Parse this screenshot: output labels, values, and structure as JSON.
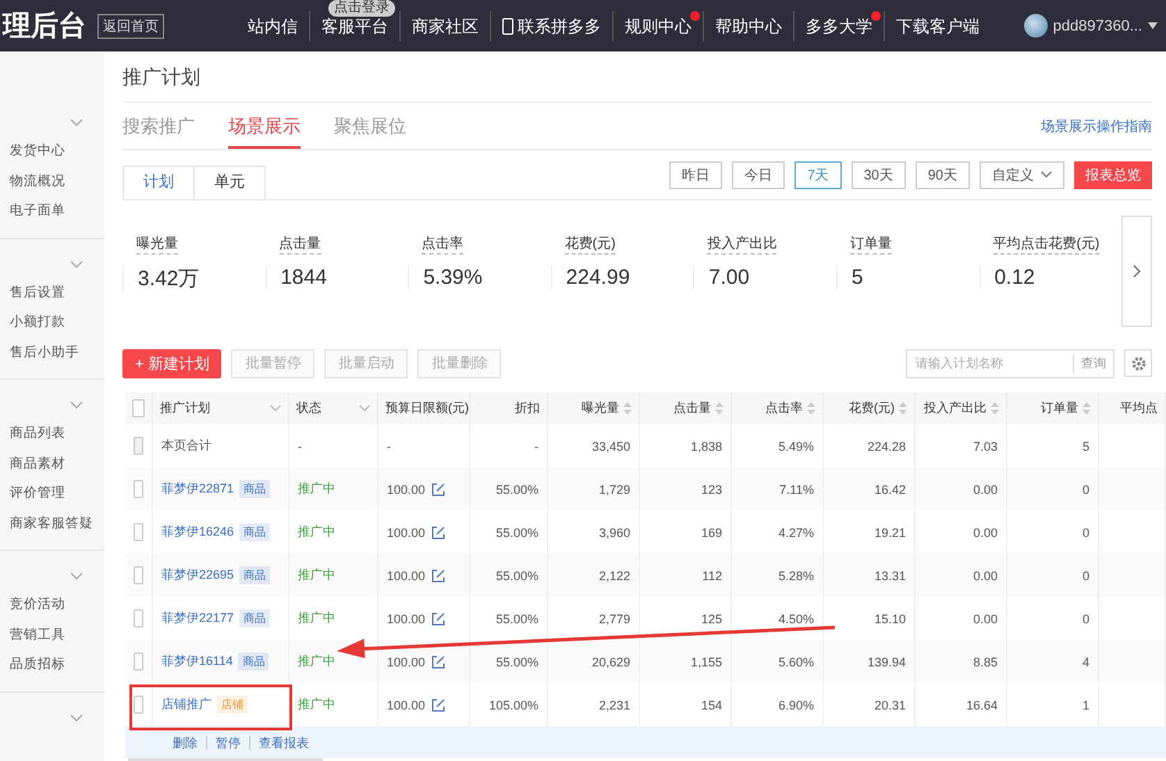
{
  "topbar": {
    "logo": "理后台",
    "home_button": "返回首页",
    "login_bubble": "点击登录",
    "nav": [
      {
        "label": "站内信",
        "kind": "text",
        "dot": false
      },
      {
        "label": "客服平台",
        "kind": "text",
        "dot": false
      },
      {
        "label": "商家社区",
        "kind": "text",
        "dot": false
      },
      {
        "label": "联系拼多多",
        "kind": "phone",
        "dot": false
      },
      {
        "label": "规则中心",
        "kind": "text",
        "dot": true
      },
      {
        "label": "帮助中心",
        "kind": "text",
        "dot": false
      },
      {
        "label": "多多大学",
        "kind": "text",
        "dot": true
      },
      {
        "label": "下载客户端",
        "kind": "text",
        "dot": false
      }
    ],
    "user": "pdd897360..."
  },
  "sidebar": {
    "groups": [
      {
        "expanded": true,
        "items": [
          "发货中心",
          "物流概况",
          "电子面单"
        ]
      },
      {
        "expanded": true,
        "items": [
          "售后设置",
          "小额打款",
          "售后小助手"
        ]
      },
      {
        "expanded": true,
        "items": [
          "商品列表",
          "商品素材",
          "评价管理",
          "商家客服答疑"
        ]
      },
      {
        "expanded": true,
        "items": [
          "竞价活动",
          "营销工具",
          "品质招标"
        ]
      },
      {
        "expanded": true
      }
    ]
  },
  "page_title": "推广计划",
  "tabs": [
    {
      "label": "搜索推广",
      "selected": false
    },
    {
      "label": "场景展示",
      "selected": true
    },
    {
      "label": "聚焦展位",
      "selected": false
    }
  ],
  "guide_link": "场景展示操作指南",
  "subtabs": [
    {
      "label": "计划",
      "selected": true
    },
    {
      "label": "单元",
      "selected": false
    }
  ],
  "date_ranges": [
    {
      "label": "昨日",
      "selected": false,
      "kind": "plain"
    },
    {
      "label": "今日",
      "selected": false,
      "kind": "plain"
    },
    {
      "label": "7天",
      "selected": true,
      "kind": "plain"
    },
    {
      "label": "30天",
      "selected": false,
      "kind": "plain"
    },
    {
      "label": "90天",
      "selected": false,
      "kind": "plain"
    },
    {
      "label": "自定义",
      "selected": false,
      "kind": "dropdown"
    }
  ],
  "report_button": "报表总览",
  "stats": [
    {
      "label": "曝光量",
      "value": "3.42万"
    },
    {
      "label": "点击量",
      "value": "1844"
    },
    {
      "label": "点击率",
      "value": "5.39%"
    },
    {
      "label": "花费(元)",
      "value": "224.99"
    },
    {
      "label": "投入产出比",
      "value": "7.00"
    },
    {
      "label": "订单量",
      "value": "5"
    },
    {
      "label": "平均点击花费(元)",
      "value": "0.12"
    }
  ],
  "toolbar": {
    "new_button": "+ 新建计划",
    "batch_buttons": [
      {
        "label": "批量暂停",
        "disabled": true
      },
      {
        "label": "批量启动",
        "disabled": true
      },
      {
        "label": "批量删除",
        "disabled": true
      }
    ],
    "search": {
      "placeholder": "请输入计划名称"
    },
    "search_button": "查询"
  },
  "table": {
    "select_all_checked": false,
    "columns": [
      {
        "label": "推广计划",
        "kind": "filter"
      },
      {
        "label": "状态",
        "kind": "filter"
      },
      {
        "label": "预算日限额(元)",
        "kind": "plain"
      },
      {
        "label": "折扣",
        "kind": "plain"
      },
      {
        "label": "曝光量",
        "kind": "sort"
      },
      {
        "label": "点击量",
        "kind": "sort"
      },
      {
        "label": "点击率",
        "kind": "sort"
      },
      {
        "label": "花费(元)",
        "kind": "sort"
      },
      {
        "label": "投入产出比",
        "kind": "sort"
      },
      {
        "label": "订单量",
        "kind": "sort"
      },
      {
        "label": "平均点",
        "kind": "plain"
      }
    ],
    "rows": [
      {
        "kind": "summary",
        "checked": false,
        "name": "本页合计",
        "status": "-",
        "budget": "-",
        "discount": "-",
        "values": [
          "33,450",
          "1,838",
          "5.49%",
          "224.28",
          "7.03",
          "5"
        ]
      },
      {
        "kind": "plan",
        "checked": false,
        "highlighted": false,
        "name": "菲梦伊22871",
        "tag": {
          "label": "商品",
          "color": "#3a72c8"
        },
        "status": "推广中",
        "budget": "100.00",
        "discount": "55.00%",
        "values": [
          "1,729",
          "123",
          "7.11%",
          "16.42",
          "0.00",
          "0"
        ]
      },
      {
        "kind": "plan",
        "checked": false,
        "highlighted": false,
        "name": "菲梦伊16246",
        "tag": {
          "label": "商品",
          "color": "#3a72c8"
        },
        "status": "推广中",
        "budget": "100.00",
        "discount": "55.00%",
        "values": [
          "3,960",
          "169",
          "4.27%",
          "19.21",
          "0.00",
          "0"
        ]
      },
      {
        "kind": "plan",
        "checked": false,
        "highlighted": false,
        "name": "菲梦伊22695",
        "tag": {
          "label": "商品",
          "color": "#3a72c8"
        },
        "status": "推广中",
        "budget": "100.00",
        "discount": "55.00%",
        "values": [
          "2,122",
          "112",
          "5.28%",
          "13.31",
          "0.00",
          "0"
        ]
      },
      {
        "kind": "plan",
        "checked": false,
        "highlighted": false,
        "name": "菲梦伊22177",
        "tag": {
          "label": "商品",
          "color": "#3a72c8"
        },
        "status": "推广中",
        "budget": "100.00",
        "discount": "55.00%",
        "values": [
          "2,779",
          "125",
          "4.50%",
          "15.10",
          "0.00",
          "0"
        ]
      },
      {
        "kind": "plan",
        "checked": false,
        "highlighted": false,
        "name": "菲梦伊16114",
        "tag": {
          "label": "商品",
          "color": "#3a72c8"
        },
        "status": "推广中",
        "budget": "100.00",
        "discount": "55.00%",
        "values": [
          "20,629",
          "1,155",
          "5.60%",
          "139.94",
          "8.85",
          "4"
        ]
      },
      {
        "kind": "plan",
        "checked": false,
        "highlighted": true,
        "name": "店铺推广",
        "tag": {
          "label": "店铺",
          "color": "#e8952c"
        },
        "status": "推广中",
        "budget": "100.00",
        "discount": "105.00%",
        "values": [
          "2,231",
          "154",
          "6.90%",
          "20.31",
          "16.64",
          "1"
        ]
      }
    ],
    "row_actions": [
      "删除",
      "暂停",
      "查看报表"
    ]
  }
}
